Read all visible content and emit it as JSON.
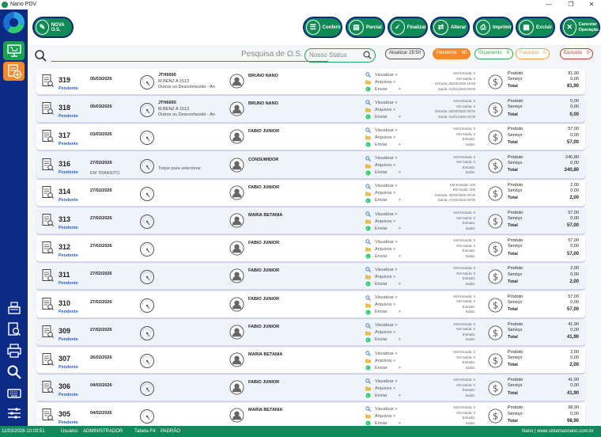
{
  "window": {
    "title": "Nano PDV",
    "controls": [
      "—",
      "❐",
      "✕"
    ]
  },
  "toolbar": {
    "nova_os": "NOVA O.S.",
    "buttons": [
      {
        "label": "Conferir",
        "icon": "clipboard-icon"
      },
      {
        "label": "Parcial",
        "icon": "receipt-icon"
      },
      {
        "label": "Finalizar",
        "icon": "check-icon"
      },
      {
        "label": "Alterar",
        "icon": "swap-icon"
      },
      {
        "label": "Imprimir",
        "icon": "printer-icon"
      },
      {
        "label": "Excluir",
        "icon": "delete-icon"
      }
    ],
    "cancel_line1": "Cancelar",
    "cancel_line2": "Operação"
  },
  "search": {
    "placeholder": "Pesquisa de O.S.",
    "status_placeholder": "Nosso Status"
  },
  "filters": {
    "atualizar": "Atualizar 29:50",
    "pills": [
      {
        "label": "Pendente",
        "count": "60",
        "color": "#f58a2a",
        "filled": true
      },
      {
        "label": "Orçamento",
        "count": "8",
        "color": "#33aa55",
        "filled": false
      },
      {
        "label": "Faturado",
        "count": "0",
        "color": "#f0a040",
        "filled": false
      },
      {
        "label": "Excluído",
        "count": "0",
        "color": "#c0392b",
        "filled": false
      }
    ]
  },
  "labels": {
    "visualizar": "Visualizar >",
    "arquivos": "Arquivos >",
    "enviar": "Enviar",
    "enviar_arrow": ">",
    "produto": "Produto",
    "servico": "Serviço",
    "total": "Total"
  },
  "rows": [
    {
      "num": "319",
      "status": "Pendente",
      "date": "05/03/2026",
      "plate": "JTH6690",
      "model": "M.BENZ A 1513",
      "color": "Outros ou Desconhecido - An",
      "client": "BRUNO NANO",
      "km": [
        "KM Entrada: 0",
        "KM Saída: 0",
        "Entrada: 05/03/2026 16:59",
        "Saída: 01/01/1900 00:00"
      ],
      "produto": "81,90",
      "servico": "0,00",
      "total": "81,90"
    },
    {
      "num": "318",
      "status": "Pendente",
      "date": "05/03/2026",
      "plate": "JTH6690",
      "model": "M.BENZ A 1513",
      "color": "Outros ou Desconhecido - An",
      "client": "BRUNO NANO",
      "km": [
        "KM Entrada: 0",
        "KM Saída: 0",
        "Entrada: 05/03/2026 09:00",
        "Saída: 01/01/1900 00:00"
      ],
      "produto": "0,00",
      "servico": "0,00",
      "total": "0,00"
    },
    {
      "num": "317",
      "status": "Pendente",
      "date": "03/03/2026",
      "client": "FABIO JUNIOR",
      "km": [
        "KM Entrada: 0",
        "KM Saída: 0",
        "Entrada:",
        "Saída:"
      ],
      "produto": "57,00",
      "servico": "0,00",
      "total": "57,00"
    },
    {
      "num": "316",
      "status": "Pendente",
      "date": "27/02/2026",
      "transit": "EM TRANSITO",
      "touch": "Toque para selecionar",
      "client": "CONSUMIDOR",
      "km": [
        "KM Entrada: 0",
        "KM Saída: 0",
        "Entrada:",
        "Saída:"
      ],
      "produto": "240,80",
      "servico": "0,00",
      "total": "240,80"
    },
    {
      "num": "314",
      "status": "Pendente",
      "date": "27/02/2026",
      "client": "FABIO JUNIOR",
      "km": [
        "KM Entrada: 100",
        "KM Saída: 200",
        "Entrada: 26/02/2026 00:00",
        "Saída: 27/02/2026 00:00"
      ],
      "produto": "2,00",
      "servico": "0,00",
      "total": "2,00"
    },
    {
      "num": "313",
      "status": "Pendente",
      "date": "27/02/2026",
      "client": "MARIA BETANIA",
      "km": [
        "KM Entrada: 0",
        "KM Saída: 0",
        "Entrada:",
        "Saída:"
      ],
      "produto": "57,00",
      "servico": "0,00",
      "total": "57,00"
    },
    {
      "num": "312",
      "status": "Pendente",
      "date": "27/02/2026",
      "client": "FABIO JUNIOR",
      "km": [
        "KM Entrada: 0",
        "KM Saída: 0",
        "Entrada:",
        "Saída:"
      ],
      "produto": "57,00",
      "servico": "0,00",
      "total": "57,00"
    },
    {
      "num": "311",
      "status": "Pendente",
      "date": "27/02/2026",
      "client": "FABIO JUNIOR",
      "km": [
        "KM Entrada: 0",
        "KM Saída: 0",
        "Entrada:",
        "Saída:"
      ],
      "produto": "2,00",
      "servico": "0,00",
      "total": "2,00"
    },
    {
      "num": "310",
      "status": "Pendente",
      "date": "27/02/2026",
      "client": "FABIO JUNIOR",
      "km": [
        "KM Entrada: 0",
        "KM Saída: 0",
        "Entrada:",
        "Saída:"
      ],
      "produto": "57,00",
      "servico": "0,00",
      "total": "57,00"
    },
    {
      "num": "309",
      "status": "Pendente",
      "date": "27/02/2026",
      "client": "FABIO JUNIOR",
      "km": [
        "KM Entrada: 0",
        "KM Saída: 0",
        "Entrada:",
        "Saída:"
      ],
      "produto": "41,90",
      "servico": "0,00",
      "total": "41,90"
    },
    {
      "num": "307",
      "status": "Pendente",
      "date": "26/02/2026",
      "client": "MARIA BETANIA",
      "km": [
        "KM Entrada: 0",
        "KM Saída: 0",
        "Entrada:",
        "Saída:"
      ],
      "produto": "2,00",
      "servico": "0,00",
      "total": "2,00"
    },
    {
      "num": "306",
      "status": "Pendente",
      "date": "04/02/2026",
      "client": "FABIO JUNIOR",
      "km": [
        "KM Entrada: 0",
        "KM Saída: 0",
        "Entrada:",
        "Saída:"
      ],
      "produto": "41,90",
      "servico": "0,00",
      "total": "41,90"
    },
    {
      "num": "305",
      "status": "Pendente",
      "date": "04/02/2026",
      "client": "MARIA BETANIA",
      "km": [
        "KM Entrada: 0",
        "KM Saída: 0",
        "Entrada:",
        "Saída:"
      ],
      "produto": "98,90",
      "servico": "0,00",
      "total": "98,90"
    }
  ],
  "statusbar": {
    "datetime": "11/03/2026 10:03:51",
    "usuario_label": "Usuário:",
    "usuario": "ADMINISTRADOR",
    "tabela_label": "Tabela F4:",
    "tabela": "PADRÃO",
    "brand": "Nano | www.sistemasnano.com.br"
  }
}
